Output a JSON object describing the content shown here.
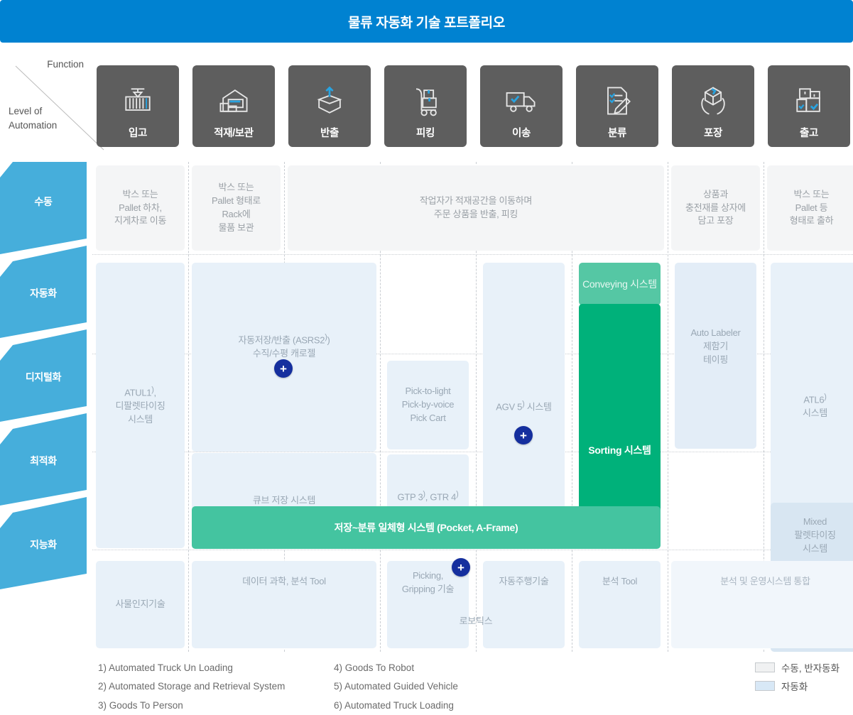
{
  "header": {
    "title": "물류 자동화 기술 포트폴리오",
    "bg": "#0082d1"
  },
  "axis": {
    "function_label": "Function",
    "level_label_line1": "Level of",
    "level_label_line2": "Automation"
  },
  "columns": [
    {
      "label": "입고",
      "icon": "container-crane-icon"
    },
    {
      "label": "적재/보관",
      "icon": "warehouse-storage-icon"
    },
    {
      "label": "반출",
      "icon": "box-outbound-arrow-icon"
    },
    {
      "label": "피킹",
      "icon": "hand-truck-boxes-icon"
    },
    {
      "label": "이송",
      "icon": "delivery-truck-check-icon"
    },
    {
      "label": "분류",
      "icon": "checklist-pencil-icon"
    },
    {
      "label": "포장",
      "icon": "hands-package-icon"
    },
    {
      "label": "출고",
      "icon": "stacked-boxes-check-icon"
    }
  ],
  "levels": [
    {
      "label": "수동"
    },
    {
      "label": "자동화"
    },
    {
      "label": "디지털화"
    },
    {
      "label": "최적화"
    },
    {
      "label": "지능화"
    }
  ],
  "cells": {
    "manual_ingo": "박스 또는\nPallet 하차,\n지게차로 이동",
    "manual_store": "박스 또는\nPallet 형태로\nRack에\n물품 보관",
    "manual_pick_span": "작업자가 적재공간을 이동하며\n주문 상품을 반출, 피킹",
    "manual_pack": "상품과\n충전재를 상자에\n담고 포장",
    "manual_ship": "박스 또는\nPallet 등\n형태로 출하",
    "atul": "ATUL1),\n디팔렛타이징\n시스템",
    "asrs": "자동저장/반출 (ASRS2))\n수직/수평 캐로젤",
    "pick_to_light": "Pick-to-light\nPick-by-voice\nPick Cart",
    "agv": "AGV 5) 시스템",
    "conveying": "Conveying 시스템",
    "sorting": "Sorting 시스템",
    "auto_labeler": "Auto Labeler\n제함기\n테이핑",
    "atl": "ATL6)\n시스템",
    "cube_storage": "큐브 저장 시스템",
    "gtp_gtr": "GTP 3), GTR 4)",
    "integrated": "저장~분류 일체형 시스템 (Pocket, A-Frame)",
    "mixed_pallet": "Mixed\n팔렛타이징\n시스템",
    "object_recog": "사물인지기술",
    "data_science": "데이터 과학, 분석 Tool",
    "picking_grip": "Picking,\nGripping 기술",
    "robotics": "로보틱스",
    "autodrive": "자동주행기술",
    "analysis_tool": "분석 Tool",
    "analysis_integration": "분석 및 운영시스템 통합"
  },
  "plus_buttons": [
    {
      "name": "plus-asrs",
      "label": "+"
    },
    {
      "name": "plus-agv",
      "label": "+"
    },
    {
      "name": "plus-picking",
      "label": "+"
    }
  ],
  "footnotes_left": [
    "1) Automated Truck Un Loading",
    "2) Automated Storage and Retrieval System",
    "3) Goods To Person"
  ],
  "footnotes_right": [
    "4) Goods To Robot",
    "5) Automated Guided Vehicle",
    "6) Automated Truck Loading"
  ],
  "legend": [
    {
      "label": "수동, 반자동화",
      "color": "#f0f1f2"
    },
    {
      "label": "자동화",
      "color": "#d8e8f6"
    }
  ],
  "colors": {
    "brand": "#0082d1",
    "header_cell": "#5e5e5e",
    "band": "#46aedb",
    "green": "#00b17a",
    "green_light": "#44c4a0",
    "plus": "#152f9e"
  }
}
